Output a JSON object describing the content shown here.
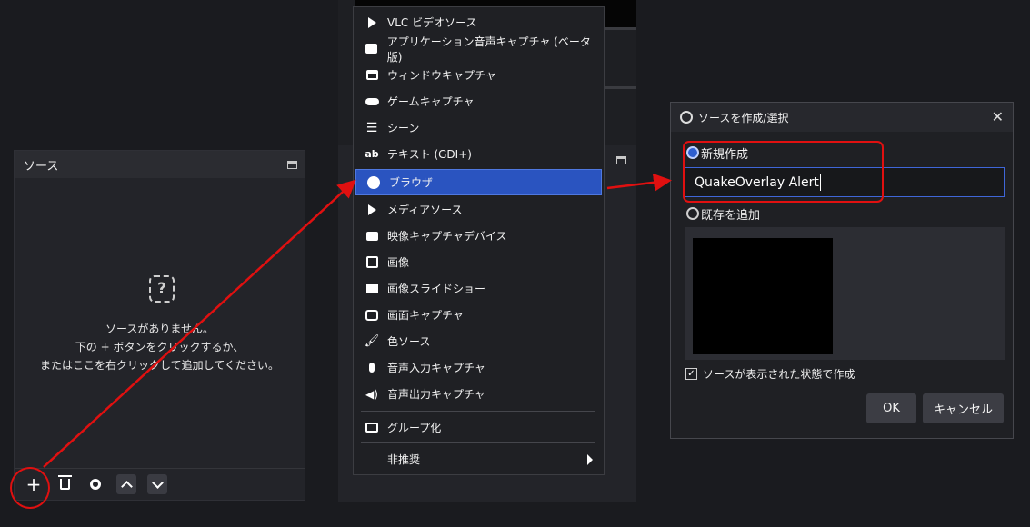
{
  "sources_dock": {
    "title": "ソース",
    "empty_line1": "ソースがありません。",
    "empty_line2": "下の + ボタンをクリックするか、",
    "empty_line3": "またはここを右クリックして追加してください。",
    "empty_icon_glyph": "?",
    "add_glyph": "+"
  },
  "menu": {
    "items": [
      {
        "label": "VLC ビデオソース",
        "icon": "play-icon"
      },
      {
        "label": "アプリケーション音声キャプチャ (ベータ版)",
        "icon": "app-audio-icon"
      },
      {
        "label": "ウィンドウキャプチャ",
        "icon": "window-icon"
      },
      {
        "label": "ゲームキャプチャ",
        "icon": "gamepad-icon"
      },
      {
        "label": "シーン",
        "icon": "list-icon"
      },
      {
        "label": "テキスト (GDI+)",
        "icon": "text-icon",
        "glyph": "ab"
      },
      {
        "label": "ブラウザ",
        "icon": "globe-icon",
        "highlighted": true
      },
      {
        "label": "メディアソース",
        "icon": "play-icon"
      },
      {
        "label": "映像キャプチャデバイス",
        "icon": "camera-icon"
      },
      {
        "label": "画像",
        "icon": "image-icon"
      },
      {
        "label": "画像スライドショー",
        "icon": "slideshow-icon"
      },
      {
        "label": "画面キャプチャ",
        "icon": "monitor-icon"
      },
      {
        "label": "色ソース",
        "icon": "brush-icon"
      },
      {
        "label": "音声入力キャプチャ",
        "icon": "microphone-icon"
      },
      {
        "label": "音声出力キャプチャ",
        "icon": "speaker-icon"
      }
    ],
    "group_label": "グループ化",
    "deprecated_label": "非推奨"
  },
  "dialog": {
    "title": "ソースを作成/選択",
    "new_label": "新規作成",
    "name_value": "QuakeOverlay Alert",
    "existing_label": "既存を追加",
    "visible_label": "ソースが表示された状態で作成",
    "visible_checked": true,
    "ok_label": "OK",
    "cancel_label": "キャンセル"
  },
  "colors": {
    "accent": "#2a54c0",
    "annotation": "#e01010"
  }
}
